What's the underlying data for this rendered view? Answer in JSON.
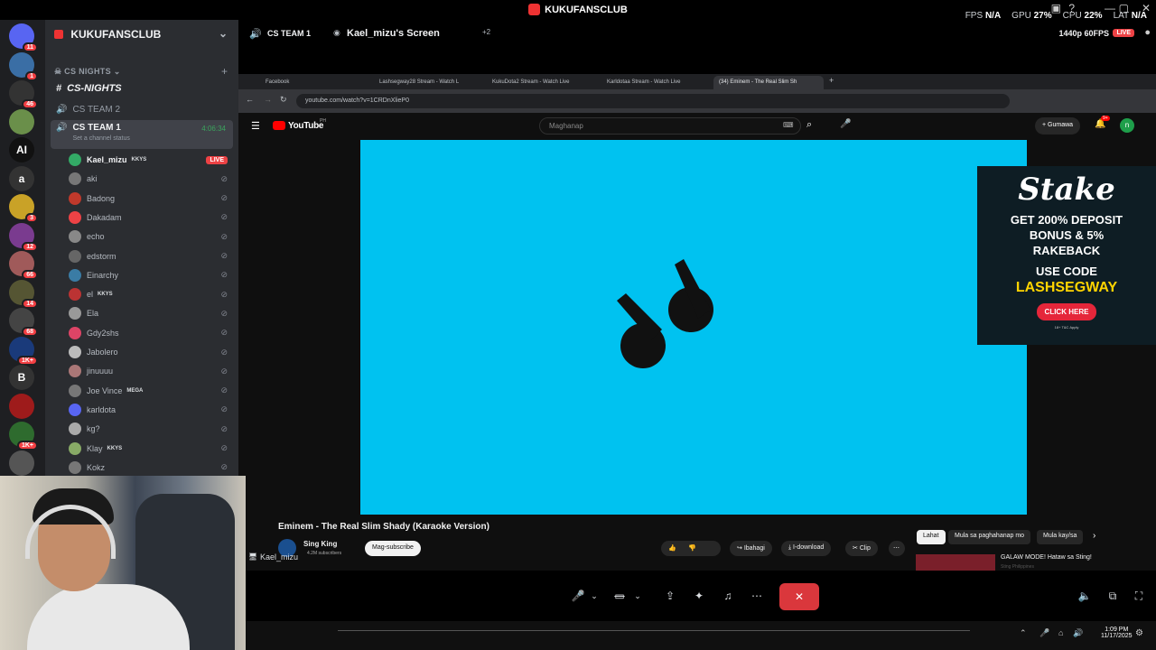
{
  "title": "KUKUFANSCLUB",
  "stats": {
    "fps_label": "FPS",
    "fps": "N/A",
    "gpu_label": "GPU",
    "gpu": "27%",
    "cpu_label": "CPU",
    "cpu": "22%",
    "lat_label": "LAT",
    "lat": "N/A"
  },
  "guilds": [
    {
      "name": "discord-home",
      "badge": "11",
      "color": "#5865f2"
    },
    {
      "name": "server-1",
      "badge": "1",
      "color": "#3a6ea5"
    },
    {
      "name": "server-2",
      "badge": "46",
      "color": "#333"
    },
    {
      "name": "server-3",
      "badge": "",
      "color": "#6a8f4a"
    },
    {
      "name": "server-ai",
      "text": "AI",
      "badge": "",
      "color": "#111"
    },
    {
      "name": "server-a",
      "text": "a",
      "badge": "",
      "color": "#333"
    },
    {
      "name": "server-pokemon",
      "badge": "3",
      "color": "#c9a227"
    },
    {
      "name": "server-sunday",
      "badge": "12",
      "color": "#7a3b8f"
    },
    {
      "name": "server-4",
      "badge": "66",
      "color": "#a05a5a"
    },
    {
      "name": "server-5",
      "badge": "14",
      "color": "#553"
    },
    {
      "name": "server-6",
      "badge": "68",
      "color": "#444"
    },
    {
      "name": "server-tl",
      "badge": "1K+",
      "color": "#1a3a7a"
    },
    {
      "name": "server-b",
      "text": "B",
      "badge": "",
      "color": "#333"
    },
    {
      "name": "server-tgl",
      "badge": "",
      "color": "#9e1b1b"
    },
    {
      "name": "server-7",
      "badge": "1K+",
      "color": "#2e6b2e"
    },
    {
      "name": "server-8",
      "badge": "",
      "color": "#555"
    }
  ],
  "sidebar": {
    "server": "KUKUFANSCLUB",
    "category": "CS NIGHTS",
    "text_channel": "CS-NIGHTS",
    "voice_channels": [
      {
        "label": "CS TEAM 2"
      },
      {
        "label": "CS TEAM 1",
        "status": "Set a channel status",
        "time": "4:06:34"
      }
    ],
    "users": [
      {
        "name": "Kael_mizu",
        "tag": "KKYS",
        "live": "LIVE",
        "color": "#3a6"
      },
      {
        "name": "aki",
        "color": "#777"
      },
      {
        "name": "Badong",
        "color": "#c0392b"
      },
      {
        "name": "Dakadam",
        "color": "#ed4245"
      },
      {
        "name": "echo",
        "color": "#888"
      },
      {
        "name": "edstorm",
        "color": "#666"
      },
      {
        "name": "Einarchy",
        "color": "#3a7ca5"
      },
      {
        "name": "el",
        "tag": "KKYS",
        "color": "#b33"
      },
      {
        "name": "Ela",
        "color": "#999"
      },
      {
        "name": "Gdy2shs",
        "color": "#d46"
      },
      {
        "name": "Jabolero",
        "color": "#bbb"
      },
      {
        "name": "jinuuuu",
        "color": "#a77"
      },
      {
        "name": "Joe Vince",
        "tag": "MEGA",
        "color": "#777"
      },
      {
        "name": "karldota",
        "color": "#5865f2"
      },
      {
        "name": "kg?",
        "color": "#aaa"
      },
      {
        "name": "Klay",
        "tag": "KKYS",
        "color": "#8a6"
      },
      {
        "name": "Kokz",
        "color": "#777"
      }
    ]
  },
  "topbar": {
    "channel": "CS TEAM 1",
    "screen": "Kael_mizu's Screen",
    "extra": "+2",
    "quality": "1440p 60FPS",
    "live": "LIVE"
  },
  "browser": {
    "tabs": [
      "Facebook",
      "Lashsegway28 Stream - Watch L",
      "KukuDota2 Stream - Watch Live",
      "Karldotaa Stream - Watch Live",
      "(34) Eminem - The Real Slim Sh"
    ],
    "url": "youtube.com/watch?v=1CRDnXlieP0",
    "youtube_logo": "YouTube",
    "region": "PH",
    "search_placeholder": "Maghanap",
    "create": "Gumawa",
    "notif": "9+",
    "avatar_letter": "n"
  },
  "ad": {
    "brand": "Stake",
    "line1": "GET 200% DEPOSIT",
    "line2": "BONUS & 5%",
    "line3": "RAKEBACK",
    "line4": "USE CODE",
    "code": "LASHSEGWAY",
    "cta": "CLICK HERE",
    "fine": "18+ T&C Apply"
  },
  "video": {
    "title": "Eminem - The Real Slim Shady (Karaoke Version)",
    "channel": "Sing King",
    "subs": "4.2M subscribers",
    "subscribe": "Mag-subscribe",
    "share": "Ibahagi",
    "download": "I-download",
    "clip": "Clip"
  },
  "chips": [
    "Lahat",
    "Mula sa paghahanap mo",
    "Mula kay/sa"
  ],
  "rec": {
    "title": "GALAW MODE! Hataw sa Sting!",
    "channel": "Sting Philippines"
  },
  "stream_user": "Kael_mizu",
  "clock": {
    "time": "1:09 PM",
    "date": "11/17/2025"
  }
}
